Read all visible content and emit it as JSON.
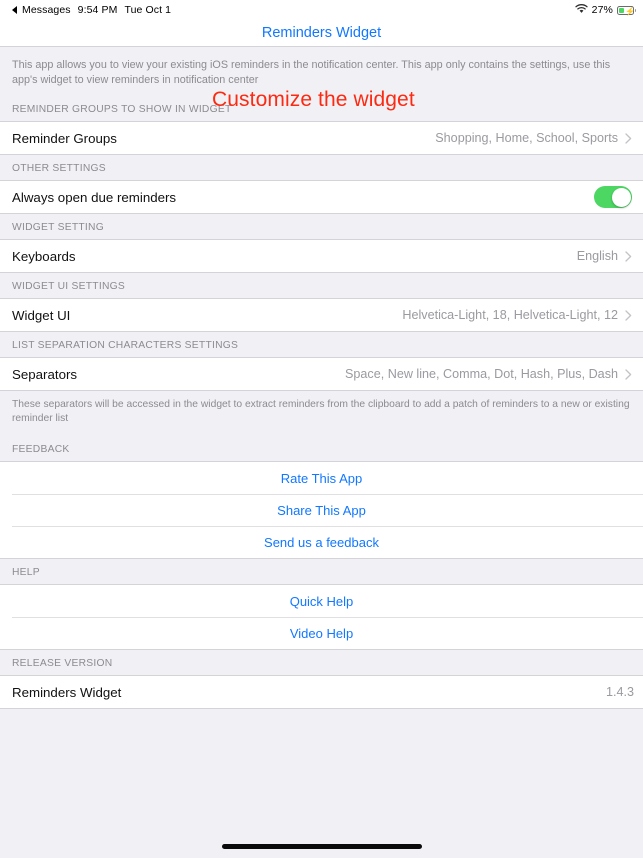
{
  "status_bar": {
    "back_app": "Messages",
    "time": "9:54 PM",
    "date": "Tue Oct 1",
    "wifi_icon": "wifi-icon",
    "battery_percent": "27%",
    "battery_icon": "battery-charging-icon"
  },
  "nav": {
    "title": "Reminders Widget"
  },
  "intro": {
    "text": "This app allows you to view your existing iOS reminders in the notification center. This app only contains the settings, use this app's widget to view reminders in notification center"
  },
  "annotation": {
    "text": "Customize the widget",
    "color": "#fc2a12"
  },
  "sections": {
    "reminder_groups": {
      "header": "REMINDER GROUPS TO SHOW IN WIDGET",
      "row": {
        "label": "Reminder Groups",
        "detail": "Shopping, Home, School, Sports"
      }
    },
    "other_settings": {
      "header": "OTHER SETTINGS",
      "row": {
        "label": "Always open due reminders",
        "toggle_on": true
      }
    },
    "widget_setting": {
      "header": "WIDGET SETTING",
      "row": {
        "label": "Keyboards",
        "detail": "English"
      }
    },
    "widget_ui_settings": {
      "header": "WIDGET UI SETTINGS",
      "row": {
        "label": "Widget UI",
        "detail": "Helvetica-Light, 18, Helvetica-Light, 12"
      }
    },
    "list_separation": {
      "header": "LIST SEPARATION CHARACTERS SETTINGS",
      "row": {
        "label": "Separators",
        "detail": "Space, New line, Comma, Dot, Hash, Plus, Dash"
      },
      "footer": "These separators will be accessed in the widget to extract reminders from the clipboard to add a patch of reminders to a new or existing reminder list"
    },
    "feedback": {
      "header": "FEEDBACK",
      "links": [
        {
          "label": "Rate This App"
        },
        {
          "label": "Share This App"
        },
        {
          "label": "Send us a feedback"
        }
      ]
    },
    "help": {
      "header": "HELP",
      "links": [
        {
          "label": "Quick Help"
        },
        {
          "label": "Video Help"
        }
      ]
    },
    "release_version": {
      "header": "RELEASE VERSION",
      "row": {
        "label": "Reminders Widget",
        "detail": "1.4.3"
      }
    }
  },
  "theme": {
    "accent_blue": "#1278ff",
    "toggle_green": "#4cd662",
    "background_gray": "#f1f1f5",
    "row_white": "#ffffff",
    "secondary_text": "#8b8b90"
  }
}
